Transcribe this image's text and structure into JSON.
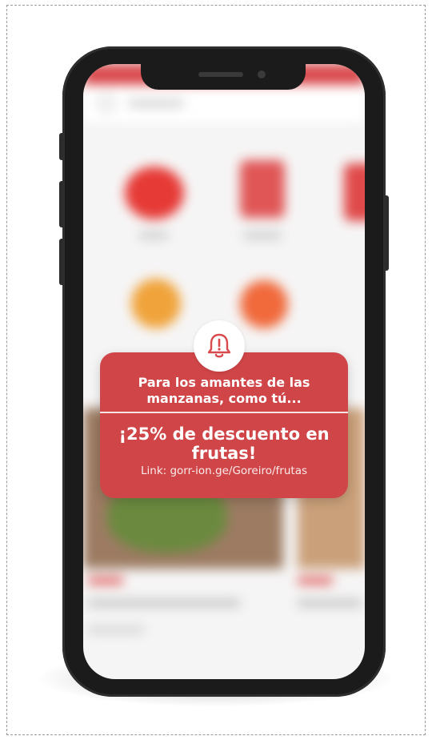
{
  "notification": {
    "title": "Para los amantes de las manzanas, como tú...",
    "headline": "¡25% de descuento en frutas!",
    "link": "Link: gorr-ion.ge/Goreiro/frutas"
  },
  "icons": {
    "alert": "bell-alert-icon"
  },
  "colors": {
    "card": "#cf4548",
    "accent": "#d94a4d",
    "frame": "#1b1b1b"
  }
}
